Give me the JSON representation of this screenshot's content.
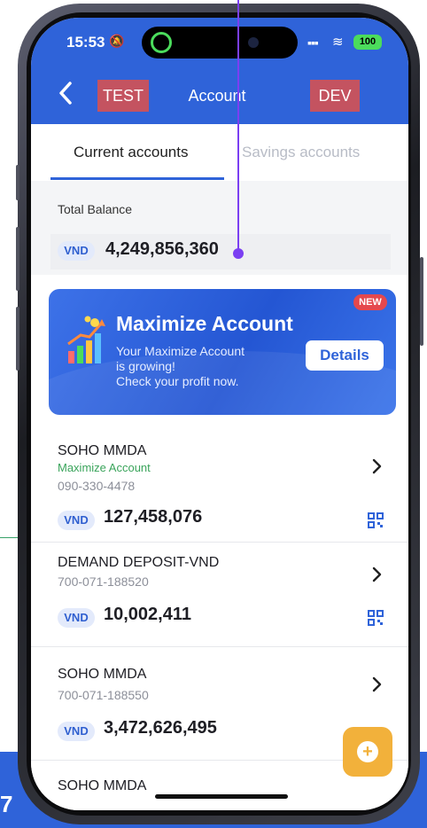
{
  "status_bar": {
    "time": "15:53",
    "battery": "100"
  },
  "header": {
    "env_left": "TEST",
    "title": "Account",
    "env_right": "DEV"
  },
  "tabs": [
    {
      "label": "Current accounts",
      "active": true
    },
    {
      "label": "Savings accounts",
      "active": false
    }
  ],
  "balance": {
    "label": "Total Balance",
    "currency": "VND",
    "amount": "4,249,856,360"
  },
  "promo": {
    "badge": "NEW",
    "title": "Maximize Account",
    "line1": "Your Maximize Account",
    "line2": "is growing!",
    "line3": "Check your profit now.",
    "button": "Details"
  },
  "accounts": [
    {
      "name": "SOHO MMDA",
      "subtitle": "Maximize Account",
      "number": "090-330-4478",
      "currency": "VND",
      "amount": "127,458,076"
    },
    {
      "name": "DEMAND DEPOSIT-VND",
      "subtitle": "",
      "number": "700-071-188520",
      "currency": "VND",
      "amount": "10,002,411"
    },
    {
      "name": "SOHO MMDA",
      "subtitle": "",
      "number": "700-071-188550",
      "currency": "VND",
      "amount": "3,472,626,495"
    },
    {
      "name": "SOHO MMDA",
      "subtitle": "",
      "number": "",
      "currency": "",
      "amount": ""
    }
  ],
  "page_digit": "7",
  "colors": {
    "brand_blue": "#2f63d9",
    "env_badge": "#c45360",
    "accent_green": "#3aa45b",
    "fab_orange": "#f2b13b",
    "new_badge": "#e5484d"
  },
  "icons": [
    "back-chevron-icon",
    "bell-muted-icon",
    "signal-icon",
    "wifi-icon",
    "battery-icon",
    "chevron-right-icon",
    "qr-code-icon",
    "plus-icon",
    "growth-chart-icon"
  ]
}
